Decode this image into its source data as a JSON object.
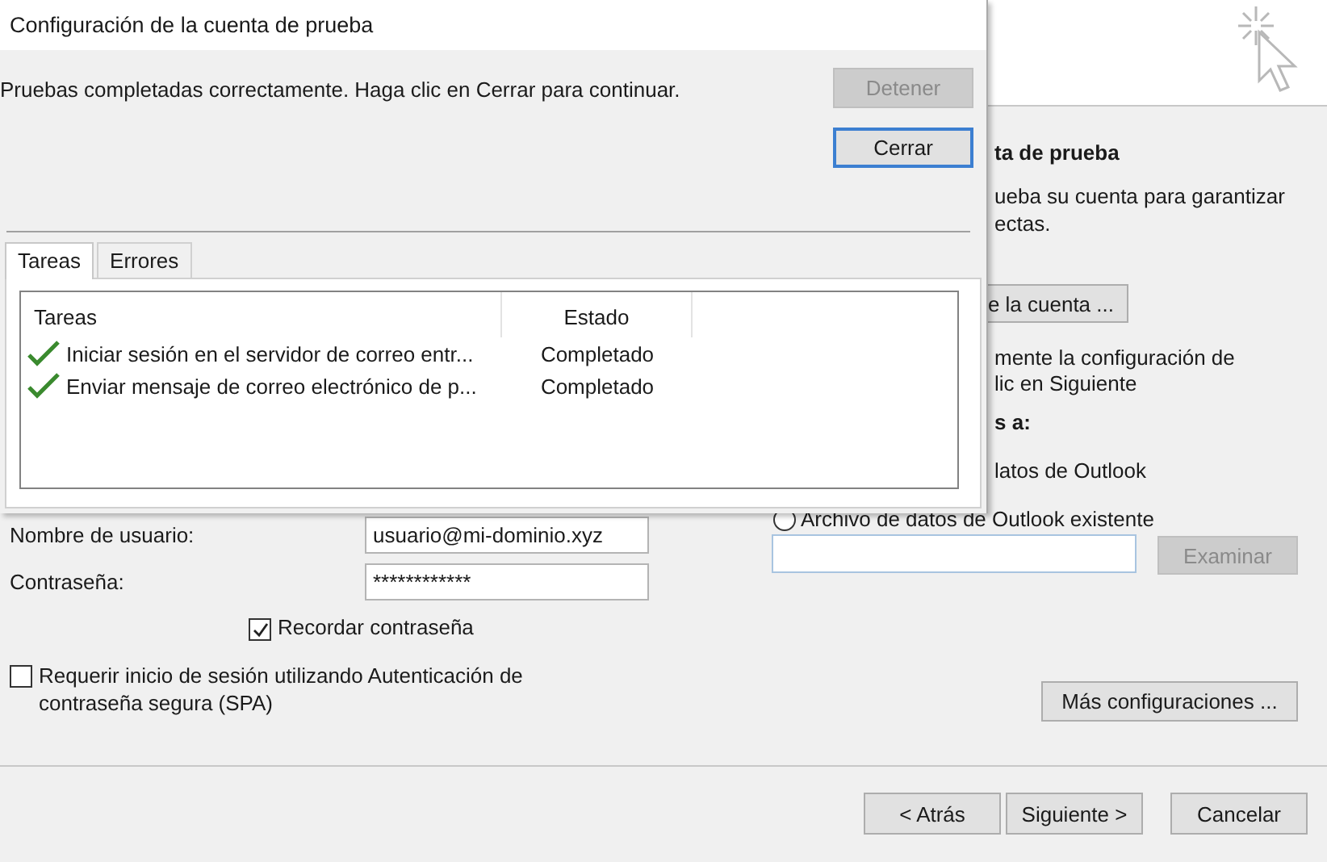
{
  "background_window": {
    "account": {
      "user_name_label": "Nombre de usuario:",
      "user_name": "usuario@mi-dominio.xyz",
      "password_label": "Contraseña:",
      "password": "************",
      "remember_password": {
        "label": "Recordar contraseña",
        "checked": true
      },
      "spa": {
        "label": "Requerir inicio de sesión utilizando Autenticación de contraseña segura (SPA)",
        "checked": false
      }
    },
    "right_panel": {
      "heading": "ta de prueba",
      "description_lines": [
        "ueba su cuenta para garantizar",
        "ectas."
      ],
      "test_button": "e la cuenta ...",
      "note_lines": [
        "mente la configuración de",
        "lic en Siguiente"
      ],
      "deliver_heading": "s a:",
      "new_data_file_label": "latos de Outlook",
      "existing_file": {
        "label": "Archivo de datos de Outlook existente",
        "selected": false
      },
      "browse_button": {
        "label": "Examinar",
        "disabled": true
      },
      "more_settings_button": "Más configuraciones ..."
    },
    "nav_buttons": [
      {
        "label": "< Atrás"
      },
      {
        "label": "Siguiente >"
      },
      {
        "label": "Cancelar"
      }
    ]
  },
  "dialog": {
    "title": "Configuración de la cuenta de prueba",
    "message": "Pruebas completadas correctamente. Haga clic en Cerrar para continuar.",
    "buttons": [
      {
        "label": "Detener",
        "disabled": true,
        "default": false
      },
      {
        "label": "Cerrar",
        "disabled": false,
        "default": true
      }
    ],
    "tabs": [
      {
        "label": "Tareas",
        "selected": true
      },
      {
        "label": "Errores",
        "selected": false
      }
    ],
    "columns": [
      "Tareas",
      "Estado"
    ],
    "rows": [
      {
        "task": "Iniciar sesión en el servidor de correo entr...",
        "status": "Completado",
        "done": true
      },
      {
        "task": "Enviar mensaje de correo electrónico de p...",
        "status": "Completado",
        "done": true
      }
    ]
  }
}
